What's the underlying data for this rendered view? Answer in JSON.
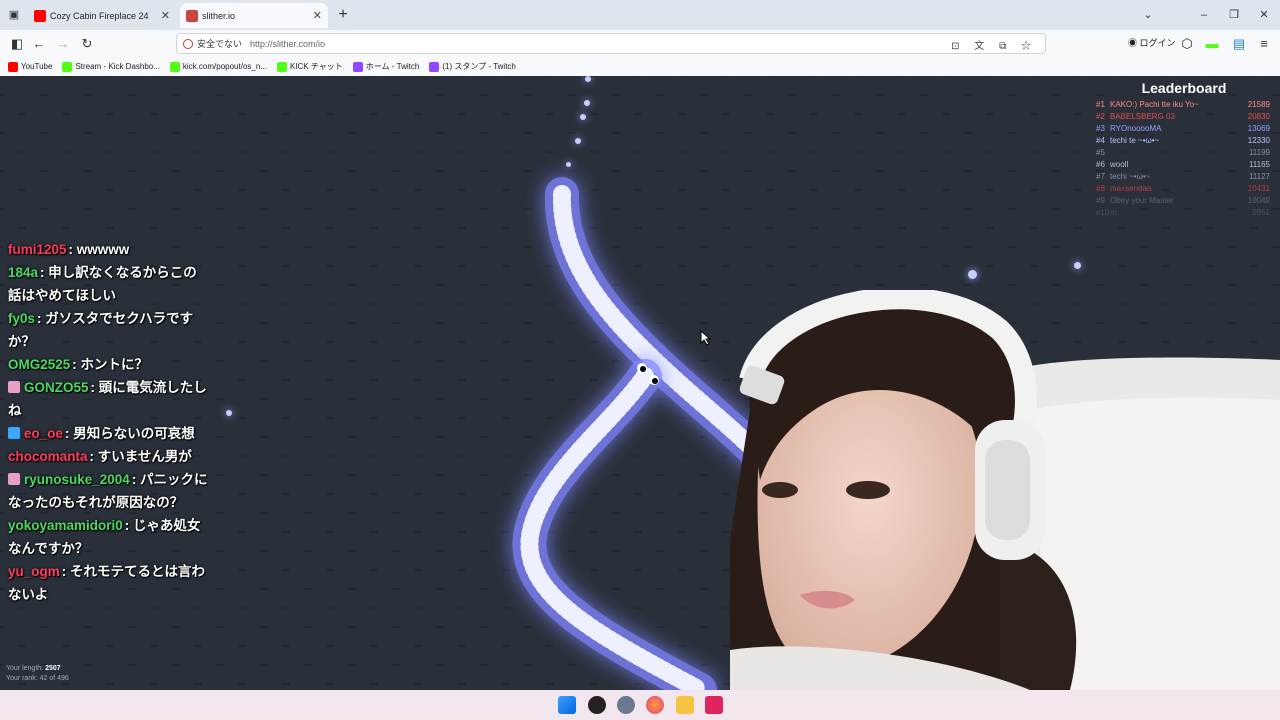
{
  "tabs": [
    {
      "title": "Cozy Cabin Fireplace 24",
      "close": "✕",
      "active": false
    },
    {
      "title": "slither.io",
      "close": "✕",
      "active": true
    }
  ],
  "navbar": {
    "security_label": "安全でない",
    "url": "http://slither.com/io",
    "login_label": "ログイン"
  },
  "bookmarks": [
    {
      "label": "YouTube",
      "color": "#ff0000"
    },
    {
      "label": "Stream - Kick Dashbo...",
      "color": "#53fc18"
    },
    {
      "label": "kick.com/popout/os_n...",
      "color": "#53fc18"
    },
    {
      "label": "KICK チャット",
      "color": "#53fc18"
    },
    {
      "label": "ホーム - Twitch",
      "color": "#9146ff"
    },
    {
      "label": "(1) スタンプ - Twitch",
      "color": "#9146ff"
    }
  ],
  "leaderboard": {
    "title": "Leaderboard",
    "rows": [
      {
        "rank": "#1",
        "name": "KAKO:) Pachi tte iku Yo~",
        "score": "21589",
        "color": "#ff8a8a"
      },
      {
        "rank": "#2",
        "name": "BABELSBERG 03",
        "score": "20830",
        "color": "#e64a4a"
      },
      {
        "rank": "#3",
        "name": "RYOnooooMA",
        "score": "13069",
        "color": "#8ea2ff"
      },
      {
        "rank": "#4",
        "name": "techi te ~•ω•~",
        "score": "12330",
        "color": "#b9c4ff"
      },
      {
        "rank": "#5",
        "name": "",
        "score": "11199",
        "color": "#8b8fa8"
      },
      {
        "rank": "#6",
        "name": "wooll",
        "score": "11165",
        "color": "#b9bcd4"
      },
      {
        "rank": "#7",
        "name": "techi ~•ω•~",
        "score": "11127",
        "color": "#8b8fa8"
      },
      {
        "rank": "#8",
        "name": "maxsendaa",
        "score": "10431",
        "color": "#b04040"
      },
      {
        "rank": "#9",
        "name": "Obey your Master",
        "score": "10049",
        "color": "#5c6072"
      },
      {
        "rank": "#10",
        "name": "m",
        "score": "9951",
        "color": "#4a4e5e"
      }
    ]
  },
  "stats": {
    "length_label": "Your length:",
    "length_value": "2507",
    "rank_label": "Your rank: 42 of 496"
  },
  "chat": [
    {
      "user": "fumi1205",
      "user_color": "#ff3b5c",
      "text": ": wwwww",
      "badge": null
    },
    {
      "user": "184a",
      "user_color": "#4cd964",
      "text": ": 申し訳なくなるからこの話はやめてほしい",
      "badge": null
    },
    {
      "user": "fy0s",
      "user_color": "#4cd964",
      "text": ": ガソスタでセクハラですか？",
      "badge": null
    },
    {
      "user": "OMG2525",
      "user_color": "#4cd964",
      "text": ": ホントに？",
      "badge": null
    },
    {
      "user": "GONZO55",
      "user_color": "#4cd964",
      "text": ": 頭に電気流したしね",
      "badge": "#e8a0c8"
    },
    {
      "user": "eo_oe",
      "user_color": "#ff3b5c",
      "text": ": 男知らないの可哀想",
      "badge": "#3aa8ff"
    },
    {
      "user": "chocomanta",
      "user_color": "#ff3b5c",
      "text": ": すいません男が",
      "badge": null
    },
    {
      "user": "ryunosuke_2004",
      "user_color": "#4cd964",
      "text": ": パニックになったのもそれが原因なの？",
      "badge": "#e8a0c8"
    },
    {
      "user": "yokoyamamidori0",
      "user_color": "#4cd964",
      "text": ": じゃあ処女なんですか？",
      "badge": null
    },
    {
      "user": "yu_ogm",
      "user_color": "#ff3b5c",
      "text": ": それモテてるとは言わないよ",
      "badge": null
    }
  ],
  "taskbar_icons": [
    "windows-icon",
    "obs-icon",
    "settings-icon",
    "firefox-icon",
    "file-explorer-icon",
    "app-icon"
  ]
}
